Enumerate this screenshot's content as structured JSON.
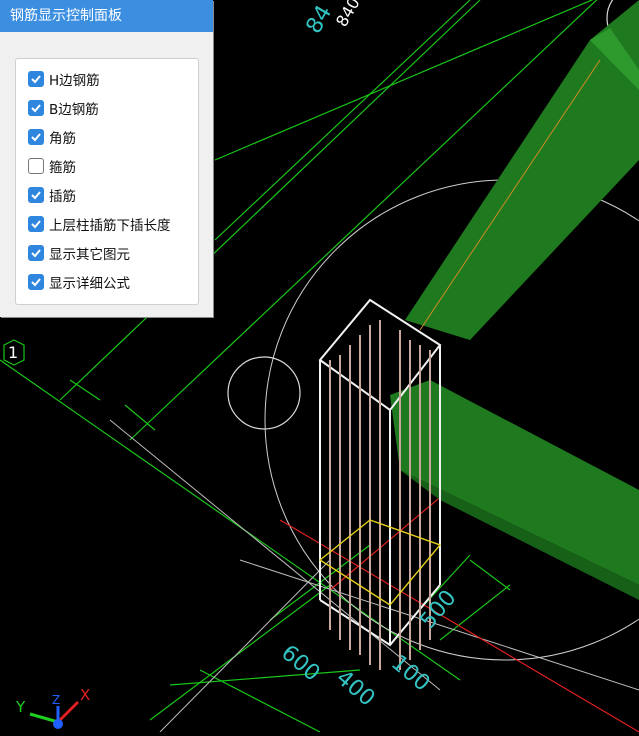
{
  "panel": {
    "title": "钢筋显示控制面板",
    "options": [
      {
        "label": "H边钢筋",
        "checked": true
      },
      {
        "label": "B边钢筋",
        "checked": true
      },
      {
        "label": "角筋",
        "checked": true
      },
      {
        "label": "箍筋",
        "checked": false
      },
      {
        "label": "插筋",
        "checked": true
      },
      {
        "label": "上层柱插筋下插长度",
        "checked": true
      },
      {
        "label": "显示其它图元",
        "checked": true
      },
      {
        "label": "显示详细公式",
        "checked": true
      }
    ]
  },
  "drawing": {
    "grid_marker": "1",
    "dims": {
      "top_a": "84",
      "top_b": "840",
      "d600": "600",
      "d400": "400",
      "d500": "500",
      "d100": "100"
    }
  },
  "axis": {
    "x": "X",
    "y": "Y",
    "z": "Z"
  },
  "colors": {
    "accent": "#3b8ee0",
    "grid_green": "#19c619",
    "beam_green": "#1f7a1f",
    "dim_cyan": "#33c3c3"
  }
}
